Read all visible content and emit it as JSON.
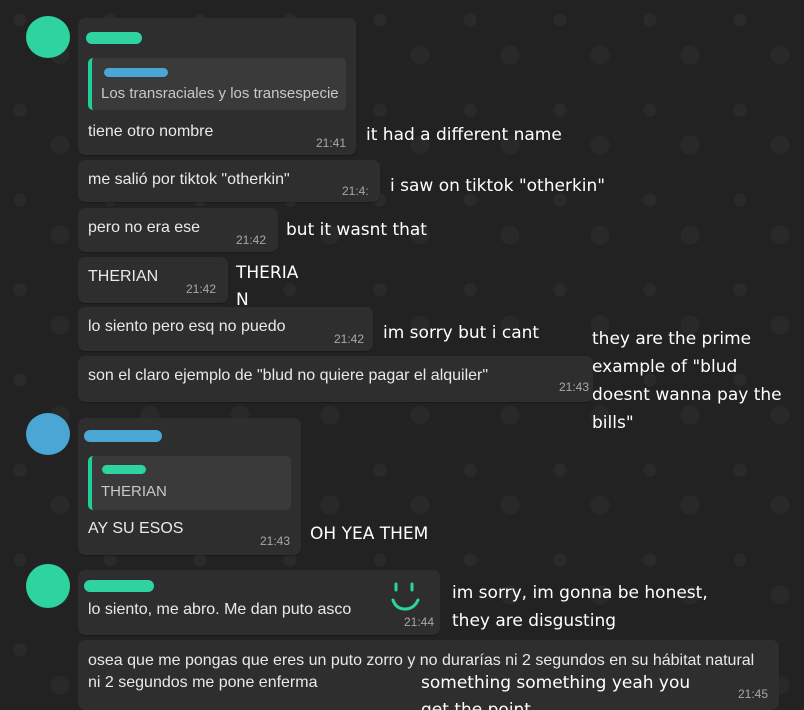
{
  "colors": {
    "background": "#222222",
    "bubble": "#2e2e2e",
    "quote_bar": "#1ecf9a",
    "avatar_green": "#2ed3a0",
    "avatar_blue": "#4aa6d4",
    "time": "#a8a8a8",
    "annotation": "#ffffff"
  },
  "messages": [
    {
      "quote": "Los transraciales y los transespecie",
      "text": "tiene otro nombre",
      "time": "21:41",
      "translation": "it had a different name"
    },
    {
      "text": "me salió por tiktok \"otherkin\"",
      "time": "21:4:",
      "translation": "i saw on tiktok \"otherkin\""
    },
    {
      "text": "pero no era ese",
      "time": "21:42",
      "translation": "but it wasnt that"
    },
    {
      "text": "THERIAN",
      "time": "21:42",
      "translation_line1": "THERIA",
      "translation_line2": "N"
    },
    {
      "text": "lo siento pero esq no puedo",
      "time": "21:42",
      "translation": "im sorry but i cant"
    },
    {
      "text": "son el claro ejemplo de \"blud no quiere pagar el alquiler\"",
      "time": "21:43",
      "translation": "they are the prime example of \"blud doesnt wanna pay the bills\""
    },
    {
      "quote": "THERIAN",
      "text": "AY SU ESOS",
      "time": "21:43",
      "translation": "OH YEA THEM"
    },
    {
      "text": "lo siento, me abro. Me dan puto asco",
      "time": "21:44",
      "translation_line1": "im sorry, im gonna be honest,",
      "translation_line2": "they are disgusting"
    },
    {
      "text": "osea que me pongas que eres un puto zorro y no durarías ni 2 segundos en su hábitat natural ni 2 segundos me pone enferma",
      "time": "21:45",
      "translation_line1": "something something yeah you",
      "translation_line2": "get the point"
    }
  ],
  "icons": {
    "avatar": "avatar-icon",
    "smiley": "drawn-smiley-icon"
  }
}
